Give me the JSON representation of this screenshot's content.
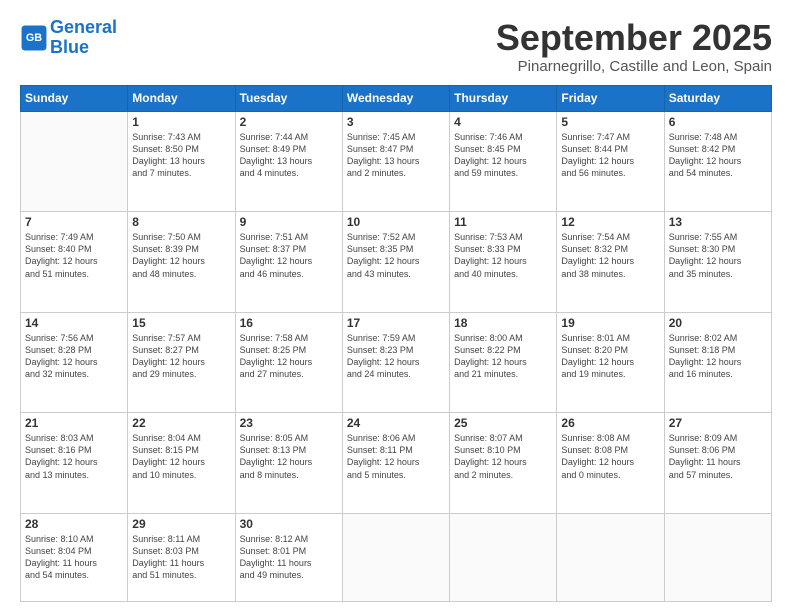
{
  "header": {
    "logo_line1": "General",
    "logo_line2": "Blue",
    "month": "September 2025",
    "location": "Pinarnegrillo, Castille and Leon, Spain"
  },
  "weekdays": [
    "Sunday",
    "Monday",
    "Tuesday",
    "Wednesday",
    "Thursday",
    "Friday",
    "Saturday"
  ],
  "weeks": [
    [
      {
        "day": "",
        "info": ""
      },
      {
        "day": "1",
        "info": "Sunrise: 7:43 AM\nSunset: 8:50 PM\nDaylight: 13 hours\nand 7 minutes."
      },
      {
        "day": "2",
        "info": "Sunrise: 7:44 AM\nSunset: 8:49 PM\nDaylight: 13 hours\nand 4 minutes."
      },
      {
        "day": "3",
        "info": "Sunrise: 7:45 AM\nSunset: 8:47 PM\nDaylight: 13 hours\nand 2 minutes."
      },
      {
        "day": "4",
        "info": "Sunrise: 7:46 AM\nSunset: 8:45 PM\nDaylight: 12 hours\nand 59 minutes."
      },
      {
        "day": "5",
        "info": "Sunrise: 7:47 AM\nSunset: 8:44 PM\nDaylight: 12 hours\nand 56 minutes."
      },
      {
        "day": "6",
        "info": "Sunrise: 7:48 AM\nSunset: 8:42 PM\nDaylight: 12 hours\nand 54 minutes."
      }
    ],
    [
      {
        "day": "7",
        "info": "Sunrise: 7:49 AM\nSunset: 8:40 PM\nDaylight: 12 hours\nand 51 minutes."
      },
      {
        "day": "8",
        "info": "Sunrise: 7:50 AM\nSunset: 8:39 PM\nDaylight: 12 hours\nand 48 minutes."
      },
      {
        "day": "9",
        "info": "Sunrise: 7:51 AM\nSunset: 8:37 PM\nDaylight: 12 hours\nand 46 minutes."
      },
      {
        "day": "10",
        "info": "Sunrise: 7:52 AM\nSunset: 8:35 PM\nDaylight: 12 hours\nand 43 minutes."
      },
      {
        "day": "11",
        "info": "Sunrise: 7:53 AM\nSunset: 8:33 PM\nDaylight: 12 hours\nand 40 minutes."
      },
      {
        "day": "12",
        "info": "Sunrise: 7:54 AM\nSunset: 8:32 PM\nDaylight: 12 hours\nand 38 minutes."
      },
      {
        "day": "13",
        "info": "Sunrise: 7:55 AM\nSunset: 8:30 PM\nDaylight: 12 hours\nand 35 minutes."
      }
    ],
    [
      {
        "day": "14",
        "info": "Sunrise: 7:56 AM\nSunset: 8:28 PM\nDaylight: 12 hours\nand 32 minutes."
      },
      {
        "day": "15",
        "info": "Sunrise: 7:57 AM\nSunset: 8:27 PM\nDaylight: 12 hours\nand 29 minutes."
      },
      {
        "day": "16",
        "info": "Sunrise: 7:58 AM\nSunset: 8:25 PM\nDaylight: 12 hours\nand 27 minutes."
      },
      {
        "day": "17",
        "info": "Sunrise: 7:59 AM\nSunset: 8:23 PM\nDaylight: 12 hours\nand 24 minutes."
      },
      {
        "day": "18",
        "info": "Sunrise: 8:00 AM\nSunset: 8:22 PM\nDaylight: 12 hours\nand 21 minutes."
      },
      {
        "day": "19",
        "info": "Sunrise: 8:01 AM\nSunset: 8:20 PM\nDaylight: 12 hours\nand 19 minutes."
      },
      {
        "day": "20",
        "info": "Sunrise: 8:02 AM\nSunset: 8:18 PM\nDaylight: 12 hours\nand 16 minutes."
      }
    ],
    [
      {
        "day": "21",
        "info": "Sunrise: 8:03 AM\nSunset: 8:16 PM\nDaylight: 12 hours\nand 13 minutes."
      },
      {
        "day": "22",
        "info": "Sunrise: 8:04 AM\nSunset: 8:15 PM\nDaylight: 12 hours\nand 10 minutes."
      },
      {
        "day": "23",
        "info": "Sunrise: 8:05 AM\nSunset: 8:13 PM\nDaylight: 12 hours\nand 8 minutes."
      },
      {
        "day": "24",
        "info": "Sunrise: 8:06 AM\nSunset: 8:11 PM\nDaylight: 12 hours\nand 5 minutes."
      },
      {
        "day": "25",
        "info": "Sunrise: 8:07 AM\nSunset: 8:10 PM\nDaylight: 12 hours\nand 2 minutes."
      },
      {
        "day": "26",
        "info": "Sunrise: 8:08 AM\nSunset: 8:08 PM\nDaylight: 12 hours\nand 0 minutes."
      },
      {
        "day": "27",
        "info": "Sunrise: 8:09 AM\nSunset: 8:06 PM\nDaylight: 11 hours\nand 57 minutes."
      }
    ],
    [
      {
        "day": "28",
        "info": "Sunrise: 8:10 AM\nSunset: 8:04 PM\nDaylight: 11 hours\nand 54 minutes."
      },
      {
        "day": "29",
        "info": "Sunrise: 8:11 AM\nSunset: 8:03 PM\nDaylight: 11 hours\nand 51 minutes."
      },
      {
        "day": "30",
        "info": "Sunrise: 8:12 AM\nSunset: 8:01 PM\nDaylight: 11 hours\nand 49 minutes."
      },
      {
        "day": "",
        "info": ""
      },
      {
        "day": "",
        "info": ""
      },
      {
        "day": "",
        "info": ""
      },
      {
        "day": "",
        "info": ""
      }
    ]
  ]
}
